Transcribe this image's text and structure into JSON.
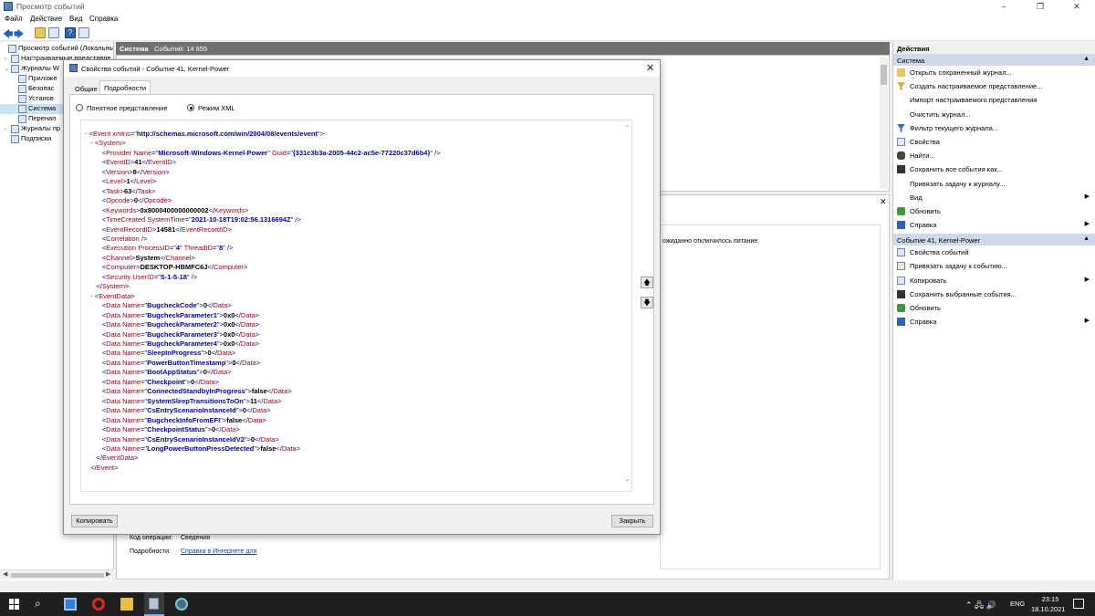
{
  "window": {
    "title": "Просмотр событий",
    "minimize": "–",
    "maximize": "❐",
    "close": "✕"
  },
  "menu": [
    "Файл",
    "Действие",
    "Вид",
    "Справка"
  ],
  "tree": {
    "items": [
      {
        "label": "Просмотр событий (Локальны",
        "arrow": ""
      },
      {
        "label": "Настраиваемые представле",
        "arrow": "›"
      },
      {
        "label": "Журналы W",
        "arrow": "⌄"
      },
      {
        "label": "Приложе",
        "arrow": ""
      },
      {
        "label": "Безопас",
        "arrow": ""
      },
      {
        "label": "Установ",
        "arrow": ""
      },
      {
        "label": "Система",
        "arrow": ""
      },
      {
        "label": "Перенап",
        "arrow": ""
      },
      {
        "label": "Журналы пр",
        "arrow": "›"
      },
      {
        "label": "Подписки",
        "arrow": ""
      }
    ]
  },
  "center": {
    "log_name": "Система",
    "event_count": "Событий: 14 855",
    "detail_text": "ожиданно отключилось питание.",
    "opcode_label": "Код операции:",
    "opcode_value": "Сведения",
    "more_label": "Подробности:",
    "more_link": "Справка в Интернете для"
  },
  "actions": {
    "header": "Действия",
    "section1": "Система",
    "items1": [
      {
        "label": "Открыть сохраненный журнал...",
        "icon": "folder-icon",
        "sub": ""
      },
      {
        "label": "Создать настраиваемое представление...",
        "icon": "filter-icon",
        "sub": ""
      },
      {
        "label": "Импорт настраиваемого представления",
        "icon": "",
        "sub": ""
      },
      {
        "label": "Очистить журнал...",
        "icon": "",
        "sub": ""
      },
      {
        "label": "Фильтр текущего журнала...",
        "icon": "filter-icon",
        "sub": ""
      },
      {
        "label": "Свойства",
        "icon": "properties-icon",
        "sub": ""
      },
      {
        "label": "Найти...",
        "icon": "binoculars-icon",
        "sub": ""
      },
      {
        "label": "Сохранить все события как...",
        "icon": "save-icon",
        "sub": ""
      },
      {
        "label": "Привязать задачу к журналу...",
        "icon": "",
        "sub": ""
      },
      {
        "label": "Вид",
        "icon": "",
        "sub": "▶"
      },
      {
        "label": "Обновить",
        "icon": "refresh-icon",
        "sub": ""
      },
      {
        "label": "Справка",
        "icon": "help-icon",
        "sub": "▶"
      }
    ],
    "section2": "Событие 41, Kernel-Power",
    "items2": [
      {
        "label": "Свойства событий",
        "icon": "properties-icon",
        "sub": ""
      },
      {
        "label": "Привязать задачу к событию...",
        "icon": "task-icon",
        "sub": ""
      },
      {
        "label": "Копировать",
        "icon": "copy-icon",
        "sub": "▶"
      },
      {
        "label": "Сохранить выбранные события...",
        "icon": "save-icon",
        "sub": ""
      },
      {
        "label": "Обновить",
        "icon": "refresh-icon",
        "sub": ""
      },
      {
        "label": "Справка",
        "icon": "help-icon",
        "sub": "▶"
      }
    ]
  },
  "dialog": {
    "title": "Свойства событий - Событие 41, Kernel-Power",
    "close": "✕",
    "tabs": {
      "general": "Общие",
      "details": "Подробности"
    },
    "view_friendly": "Понятное представление",
    "view_xml": "Режим XML",
    "copy_button": "Копировать",
    "close_button": "Закрыть",
    "xml": {
      "event_xmlns": "http://schemas.microsoft.com/win/2004/08/events/event",
      "provider_name": "Microsoft-Windows-Kernel-Power",
      "provider_guid": "{331c3b3a-2005-44c2-ac5e-77220c37d6b4}",
      "event_id": "41",
      "version": "8",
      "level": "1",
      "task": "63",
      "opcode": "0",
      "keywords": "0x8000400000000002",
      "time_created": "2021-10-18T19:02:56.1316694Z",
      "record_id": "14581",
      "process_id": "4",
      "thread_id": "8",
      "channel": "System",
      "computer": "DESKTOP-HBMFC6J",
      "user_id": "S-1-5-18",
      "data": [
        {
          "name": "BugcheckCode",
          "value": "0"
        },
        {
          "name": "BugcheckParameter1",
          "value": "0x0"
        },
        {
          "name": "BugcheckParameter2",
          "value": "0x0"
        },
        {
          "name": "BugcheckParameter3",
          "value": "0x0"
        },
        {
          "name": "BugcheckParameter4",
          "value": "0x0"
        },
        {
          "name": "SleepInProgress",
          "value": "0"
        },
        {
          "name": "PowerButtonTimestamp",
          "value": "0"
        },
        {
          "name": "BootAppStatus",
          "value": "0"
        },
        {
          "name": "Checkpoint",
          "value": "0"
        },
        {
          "name": "ConnectedStandbyInProgress",
          "value": "false"
        },
        {
          "name": "SystemSleepTransitionsToOn",
          "value": "11"
        },
        {
          "name": "CsEntryScenarioInstanceId",
          "value": "0"
        },
        {
          "name": "BugcheckInfoFromEFI",
          "value": "false"
        },
        {
          "name": "CheckpointStatus",
          "value": "0"
        },
        {
          "name": "CsEntryScenarioInstanceIdV2",
          "value": "0"
        },
        {
          "name": "LongPowerButtonPressDetected",
          "value": "false"
        }
      ]
    }
  },
  "taskbar": {
    "language": "ENG",
    "time": "23:15",
    "date": "18.10.2021",
    "tray_icons": "⌃ 🖧 🔊"
  }
}
